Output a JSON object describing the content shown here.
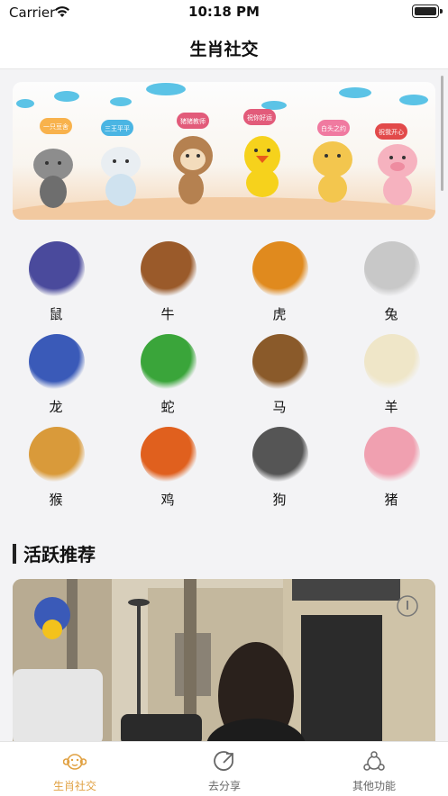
{
  "status": {
    "carrier": "Carrier",
    "time": "10:18 PM"
  },
  "nav": {
    "title": "生肖社交"
  },
  "banner": {
    "bubbles": [
      "一只豆舍",
      "三王平平",
      "猪猪教师",
      "祝你好运",
      "白头之约",
      "祝我开心"
    ]
  },
  "zodiac": [
    {
      "label": "鼠",
      "icon": "rat-icon",
      "color": "#4a4a9c"
    },
    {
      "label": "牛",
      "icon": "ox-icon",
      "color": "#9a5a2a"
    },
    {
      "label": "虎",
      "icon": "tiger-icon",
      "color": "#e08a1e"
    },
    {
      "label": "兔",
      "icon": "rabbit-icon",
      "color": "#c8c8c8"
    },
    {
      "label": "龙",
      "icon": "dragon-icon",
      "color": "#3a5ab8"
    },
    {
      "label": "蛇",
      "icon": "snake-icon",
      "color": "#3aa53a"
    },
    {
      "label": "马",
      "icon": "horse-icon",
      "color": "#8a5a2a"
    },
    {
      "label": "羊",
      "icon": "sheep-icon",
      "color": "#efe6c8"
    },
    {
      "label": "猴",
      "icon": "monkey-icon",
      "color": "#d99a3a"
    },
    {
      "label": "鸡",
      "icon": "rooster-icon",
      "color": "#e0601e"
    },
    {
      "label": "狗",
      "icon": "dog-icon",
      "color": "#555555"
    },
    {
      "label": "猪",
      "icon": "pig-icon",
      "color": "#f0a0b0"
    }
  ],
  "section": {
    "title": "活跃推荐"
  },
  "tabs": [
    {
      "label": "生肖社交",
      "icon": "monkey-face-icon",
      "active": true
    },
    {
      "label": "去分享",
      "icon": "share-icon",
      "active": false
    },
    {
      "label": "其他功能",
      "icon": "network-icon",
      "active": false
    }
  ],
  "colors": {
    "accent": "#e0a040",
    "inactive": "#666666"
  }
}
